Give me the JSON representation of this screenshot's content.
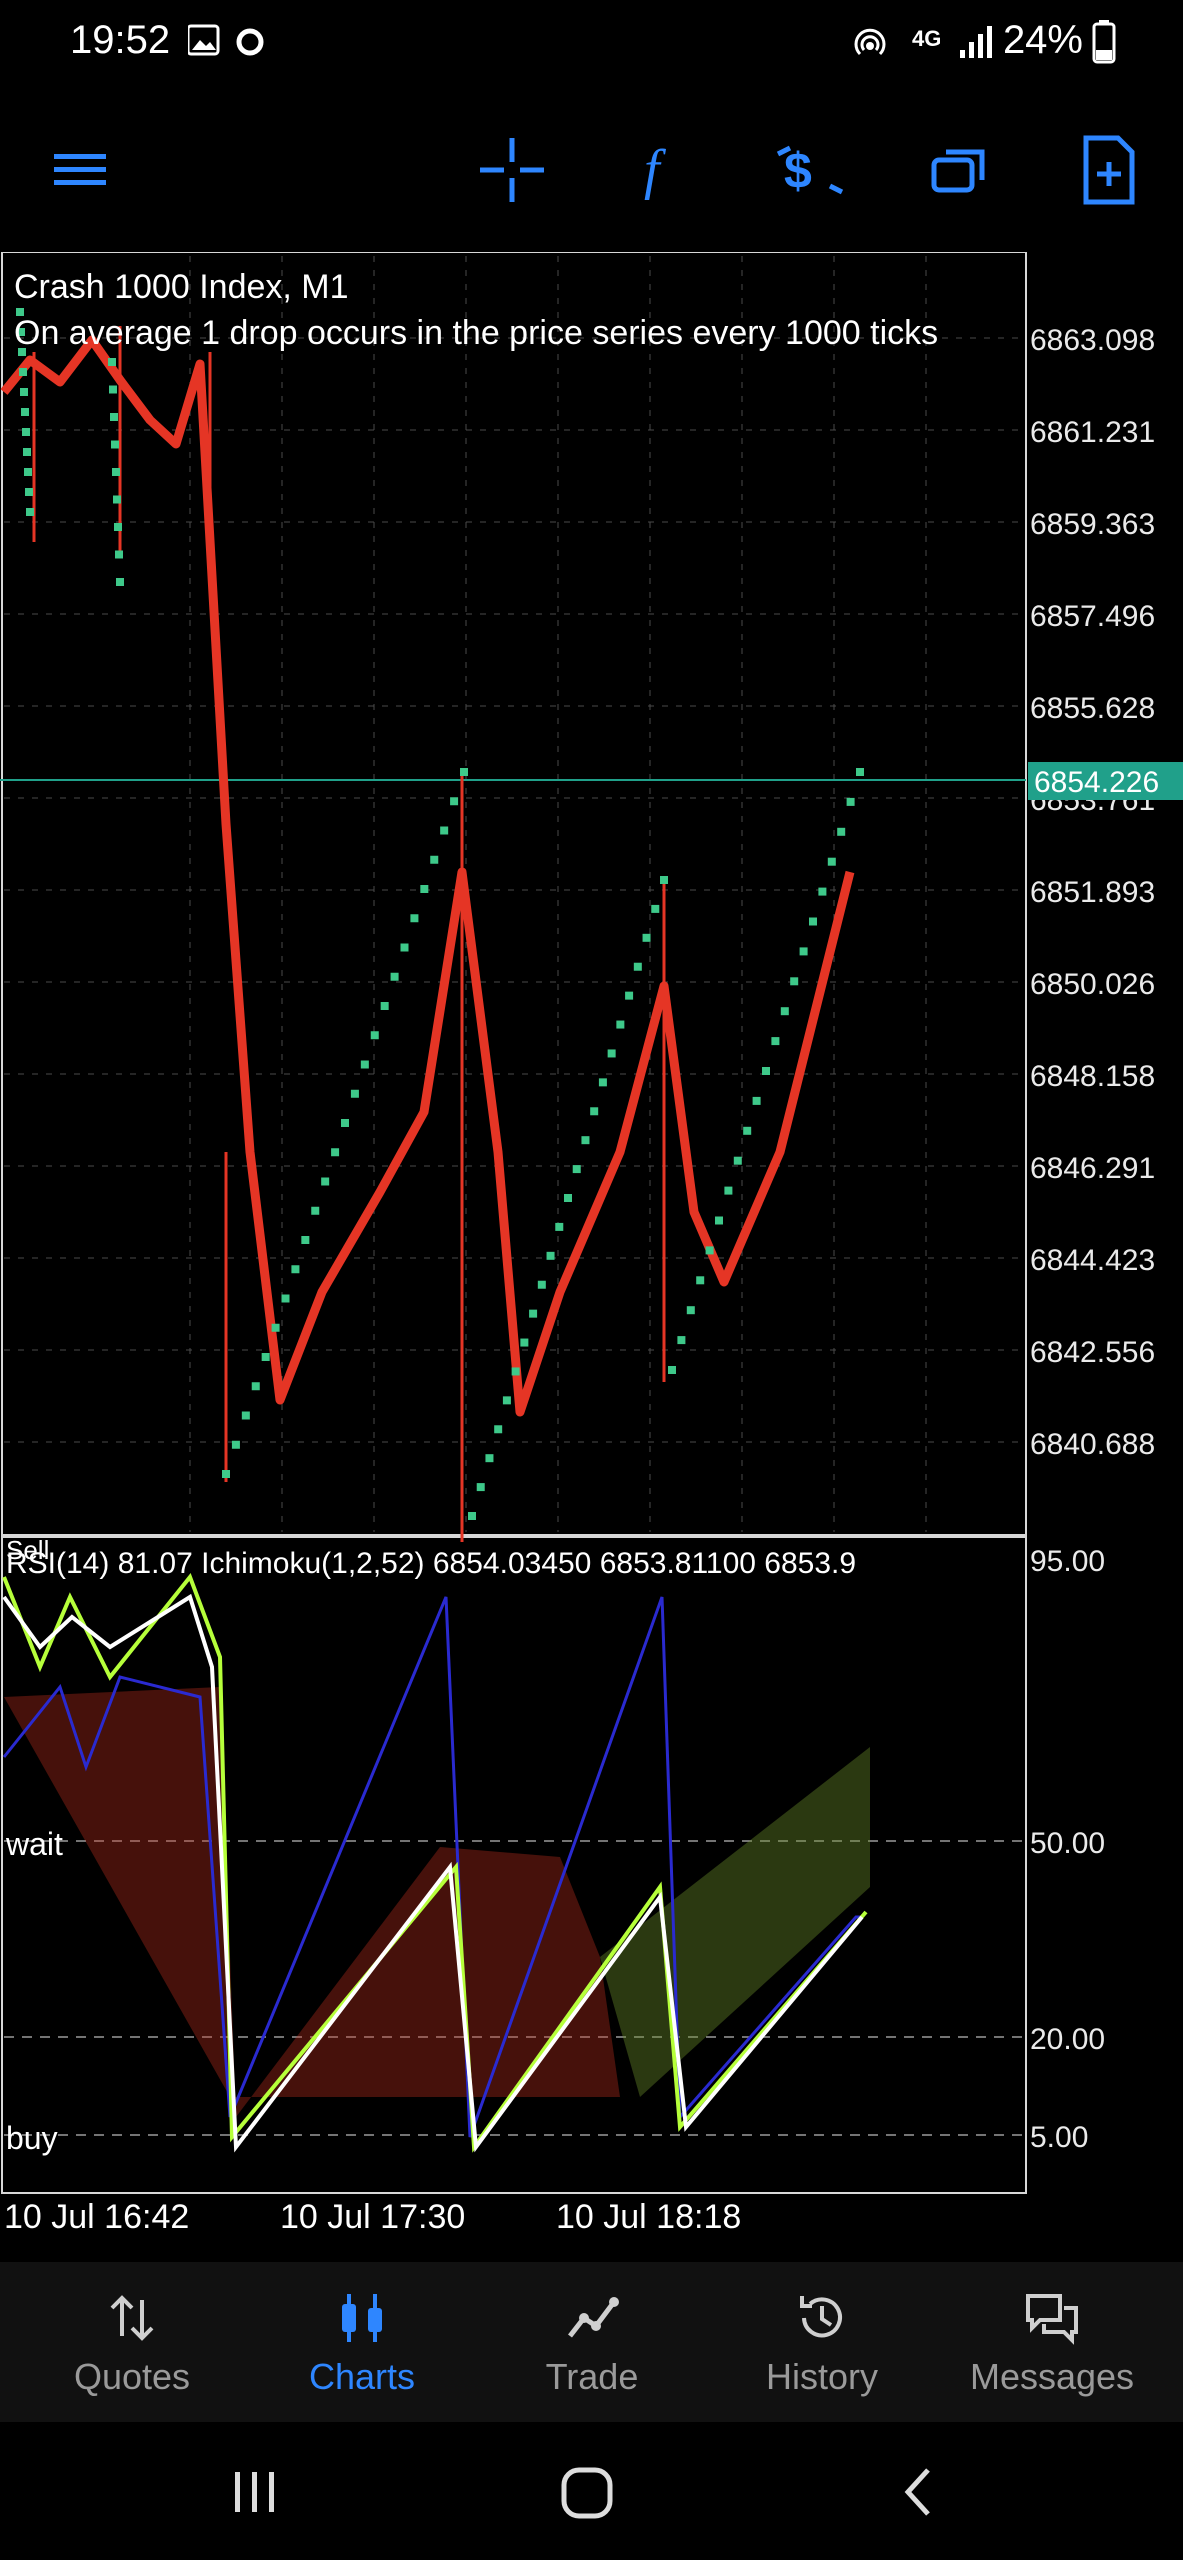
{
  "status_bar": {
    "time": "19:52",
    "network": "4G",
    "battery": "24%"
  },
  "toolbar": {
    "icons": [
      "menu-icon",
      "crosshair-icon",
      "indicators-icon",
      "trade-icon",
      "windows-icon",
      "new-order-icon"
    ]
  },
  "chart": {
    "title": "Crash 1000 Index, M1",
    "description": "On average 1 drop occurs in the price series every 1000 ticks",
    "current_price": "6854.226",
    "price_labels": [
      "6863.098",
      "6861.231",
      "6859.363",
      "6857.496",
      "6855.628",
      "6853.761",
      "6851.893",
      "6850.026",
      "6848.158",
      "6846.291",
      "6844.423",
      "6842.556",
      "6840.688"
    ],
    "indicator_text": "Sell",
    "indicator_legend": "RSI(14) 81.07 Ichimoku(1,2,52) 6854.03450 6853.81100 6853.9",
    "indicator_levels": [
      "95.00",
      "50.00",
      "20.00",
      "5.00"
    ],
    "zone_labels": [
      "wait",
      "buy"
    ],
    "time_labels": [
      "10 Jul 16:42",
      "10 Jul 17:30",
      "10 Jul 18:18"
    ],
    "colors": {
      "price_line": "#e53525",
      "sar_dots": "#3ec98a",
      "current_price_bg": "#20a08a",
      "rsi": "#ffffff",
      "ichimoku_fast": "#b6ff3a",
      "ichimoku_slow": "#2a2ad0",
      "cloud_red": "#c8301f",
      "cloud_green": "#6b8f2a"
    }
  },
  "bottom_nav": [
    {
      "label": "Quotes",
      "icon": "quotes-icon",
      "active": false
    },
    {
      "label": "Charts",
      "icon": "charts-icon",
      "active": true
    },
    {
      "label": "Trade",
      "icon": "trade-chart-icon",
      "active": false
    },
    {
      "label": "History",
      "icon": "history-icon",
      "active": false
    },
    {
      "label": "Messages",
      "icon": "messages-icon",
      "active": false
    }
  ],
  "system_nav": [
    "recent-apps-icon",
    "home-icon",
    "back-icon"
  ]
}
